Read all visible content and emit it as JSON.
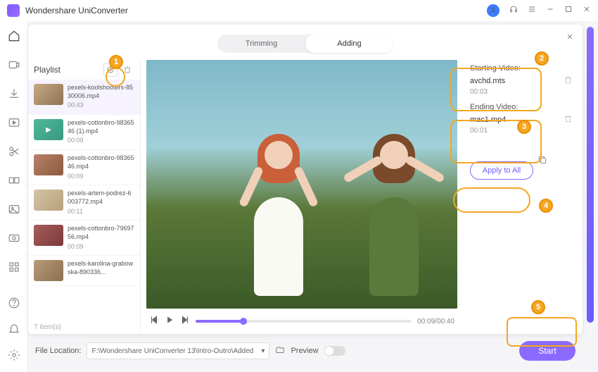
{
  "app": {
    "title": "Wondershare UniConverter"
  },
  "window_icons": {
    "avatar": "👤"
  },
  "tabs": {
    "trimming": "Trimming",
    "adding": "Adding"
  },
  "playlist": {
    "title": "Playlist",
    "items": [
      {
        "name": "pexels-koolshooters-8530006.mp4",
        "duration": "00:43"
      },
      {
        "name": "pexels-cottonbro-9836546 (1).mp4",
        "duration": "00:09"
      },
      {
        "name": "pexels-cottonbro-9836546.mp4",
        "duration": "00:09"
      },
      {
        "name": "pexels-artem-podrez-6003772.mp4",
        "duration": "00:11"
      },
      {
        "name": "pexels-cottonbro-7969756.mp4",
        "duration": "00:09"
      },
      {
        "name": "pexels-karolina-grabowska-890336...",
        "duration": ""
      }
    ],
    "count_label": "7 item(s)"
  },
  "player": {
    "time": "00:09/00:40"
  },
  "right": {
    "starting_label": "Starting Video:",
    "starting_file": "avchd.mts",
    "starting_dur": "00:03",
    "ending_label": "Ending Video:",
    "ending_file": "mac1.mp4",
    "ending_dur": "00:01",
    "apply_label": "Apply to All"
  },
  "bottom": {
    "location_label": "File Location:",
    "path": "F:\\Wondershare UniConverter 13\\Intro-Outro\\Added",
    "preview_label": "Preview",
    "start_label": "Start"
  },
  "callouts": {
    "c1": "1",
    "c2": "2",
    "c3": "3",
    "c4": "4",
    "c5": "5"
  }
}
